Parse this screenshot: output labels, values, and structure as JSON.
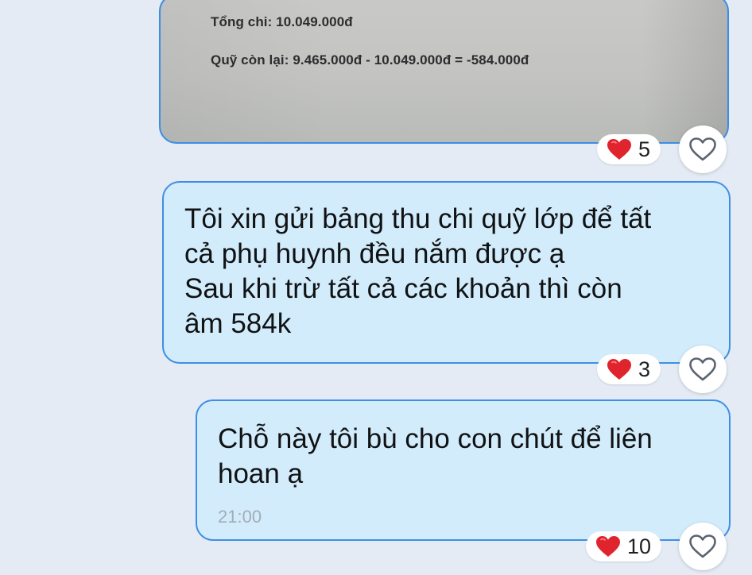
{
  "photo": {
    "lines": [
      "Tổng chi: 10.049.000đ",
      "Quỹ còn lại: 9.465.000đ - 10.049.000đ = -584.000đ"
    ]
  },
  "messages": [
    {
      "text": "Tôi xin gửi bảng thu chi quỹ lớp để tất\ncả phụ huynh đều nắm được ạ\nSau khi trừ tất cả các khoản thì còn\nâm 584k"
    },
    {
      "text": "Chỗ này tôi bù cho con chút để liên\nhoan ạ",
      "time": "21:00"
    }
  ],
  "reactions": [
    {
      "emoji": "red-heart-icon",
      "count": "5"
    },
    {
      "emoji": "red-heart-icon",
      "count": "3"
    },
    {
      "emoji": "red-heart-icon",
      "count": "10"
    }
  ],
  "colors": {
    "background": "#e4ebf4",
    "bubble_fill": "#d3ecfb",
    "bubble_border": "#3d8fe4",
    "heart": "#e0242e",
    "timestamp": "#a2adb8"
  }
}
